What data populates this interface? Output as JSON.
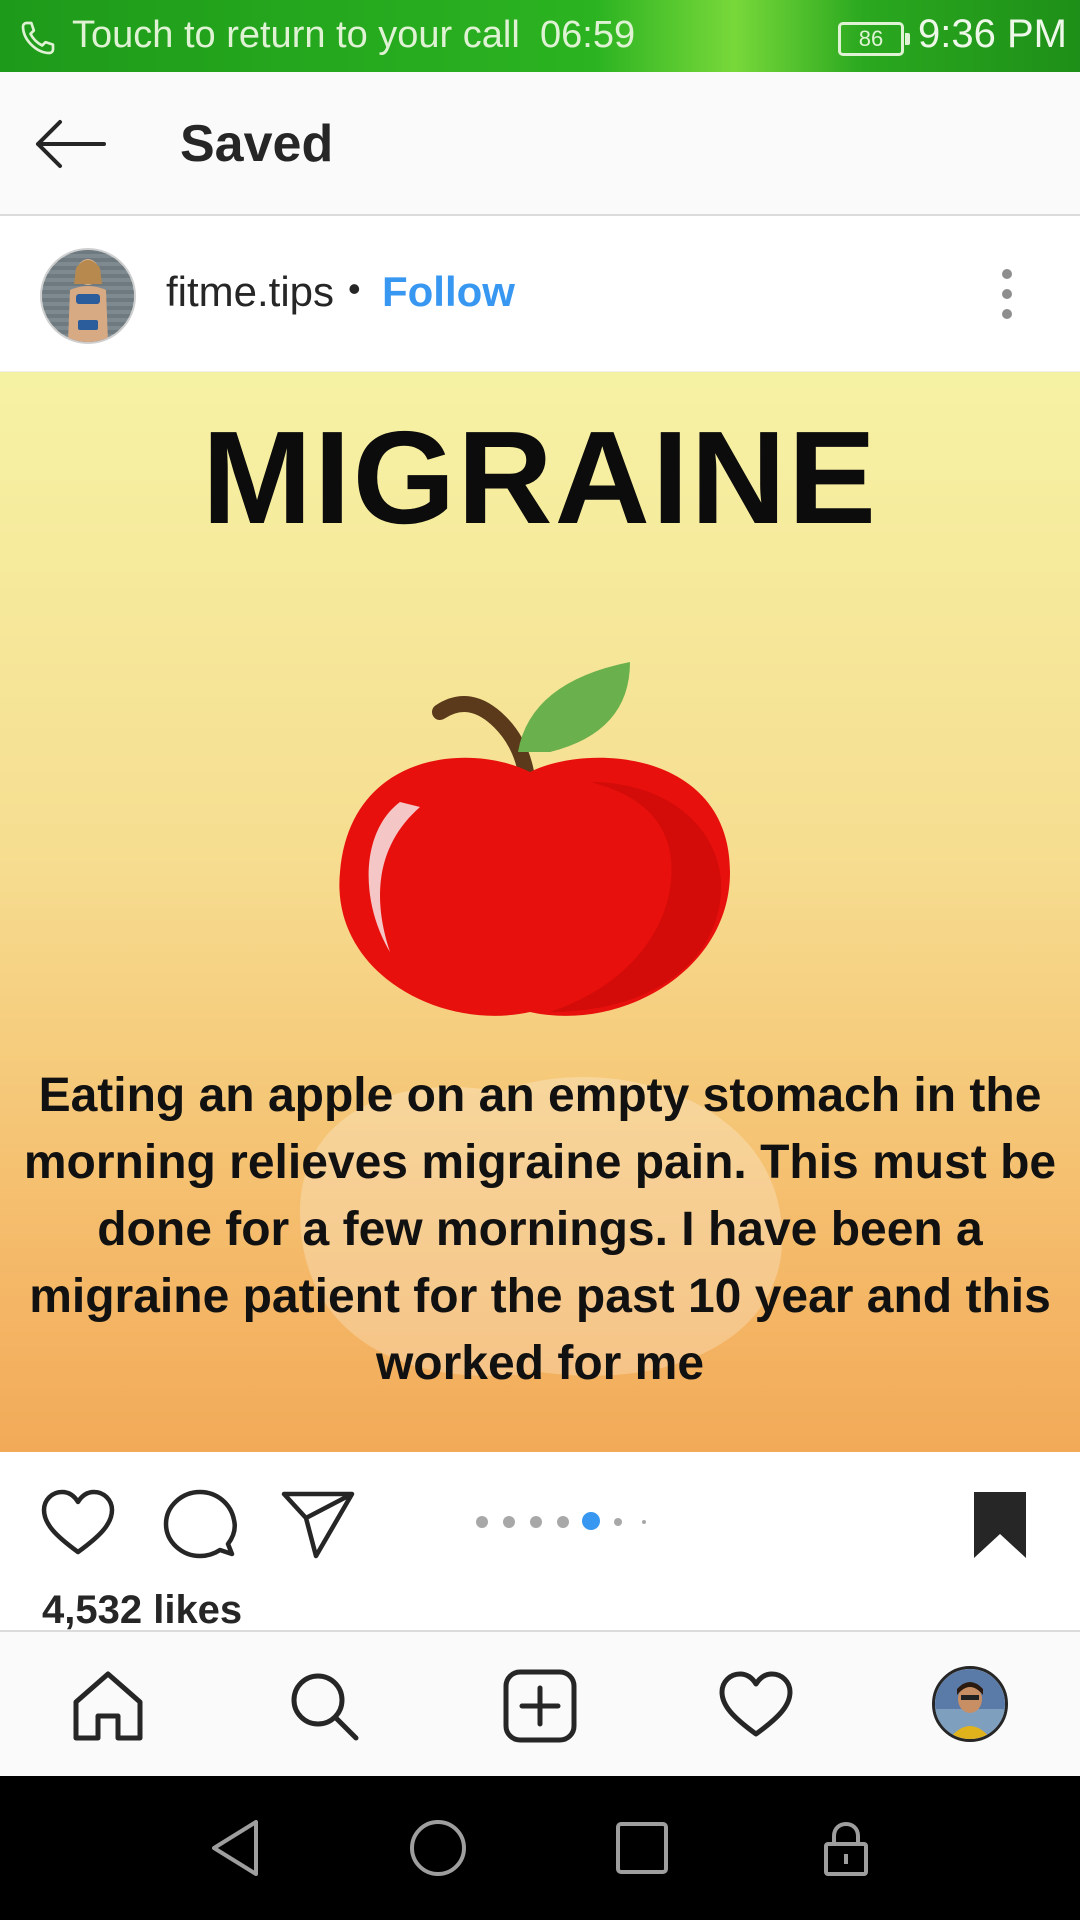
{
  "status_bar": {
    "call_text": "Touch to return to your call",
    "call_timer": "06:59",
    "battery": "86",
    "time": "9:36 PM",
    "call_icon": "phone-icon"
  },
  "header": {
    "title": "Saved",
    "back_icon": "arrow-left-icon"
  },
  "post": {
    "username": "fitme.tips",
    "separator": "•",
    "follow_label": "Follow",
    "more_icon": "more-vertical-icon",
    "image": {
      "headline": "MIGRAINE",
      "body": "Eating an apple on an empty stomach in the morning relieves migraine pain. This must be done for a few mornings. I have been a migraine patient for the past 10 year and this worked for me"
    },
    "actions": {
      "like_icon": "heart-icon",
      "comment_icon": "comment-icon",
      "share_icon": "send-icon",
      "save_icon": "bookmark-filled-icon"
    },
    "carousel": {
      "total_dots": 7,
      "active_index": 4
    },
    "likes": "4,532 likes"
  },
  "bottom_nav": {
    "items": [
      "home-icon",
      "search-icon",
      "add-post-icon",
      "activity-heart-icon",
      "profile-avatar"
    ]
  },
  "system_nav": {
    "items": [
      "back-triangle-icon",
      "home-circle-icon",
      "recents-square-icon",
      "lock-icon"
    ]
  },
  "colors": {
    "accent": "#3897f0",
    "status_bar_green": "#2bb321",
    "text": "#262626"
  }
}
